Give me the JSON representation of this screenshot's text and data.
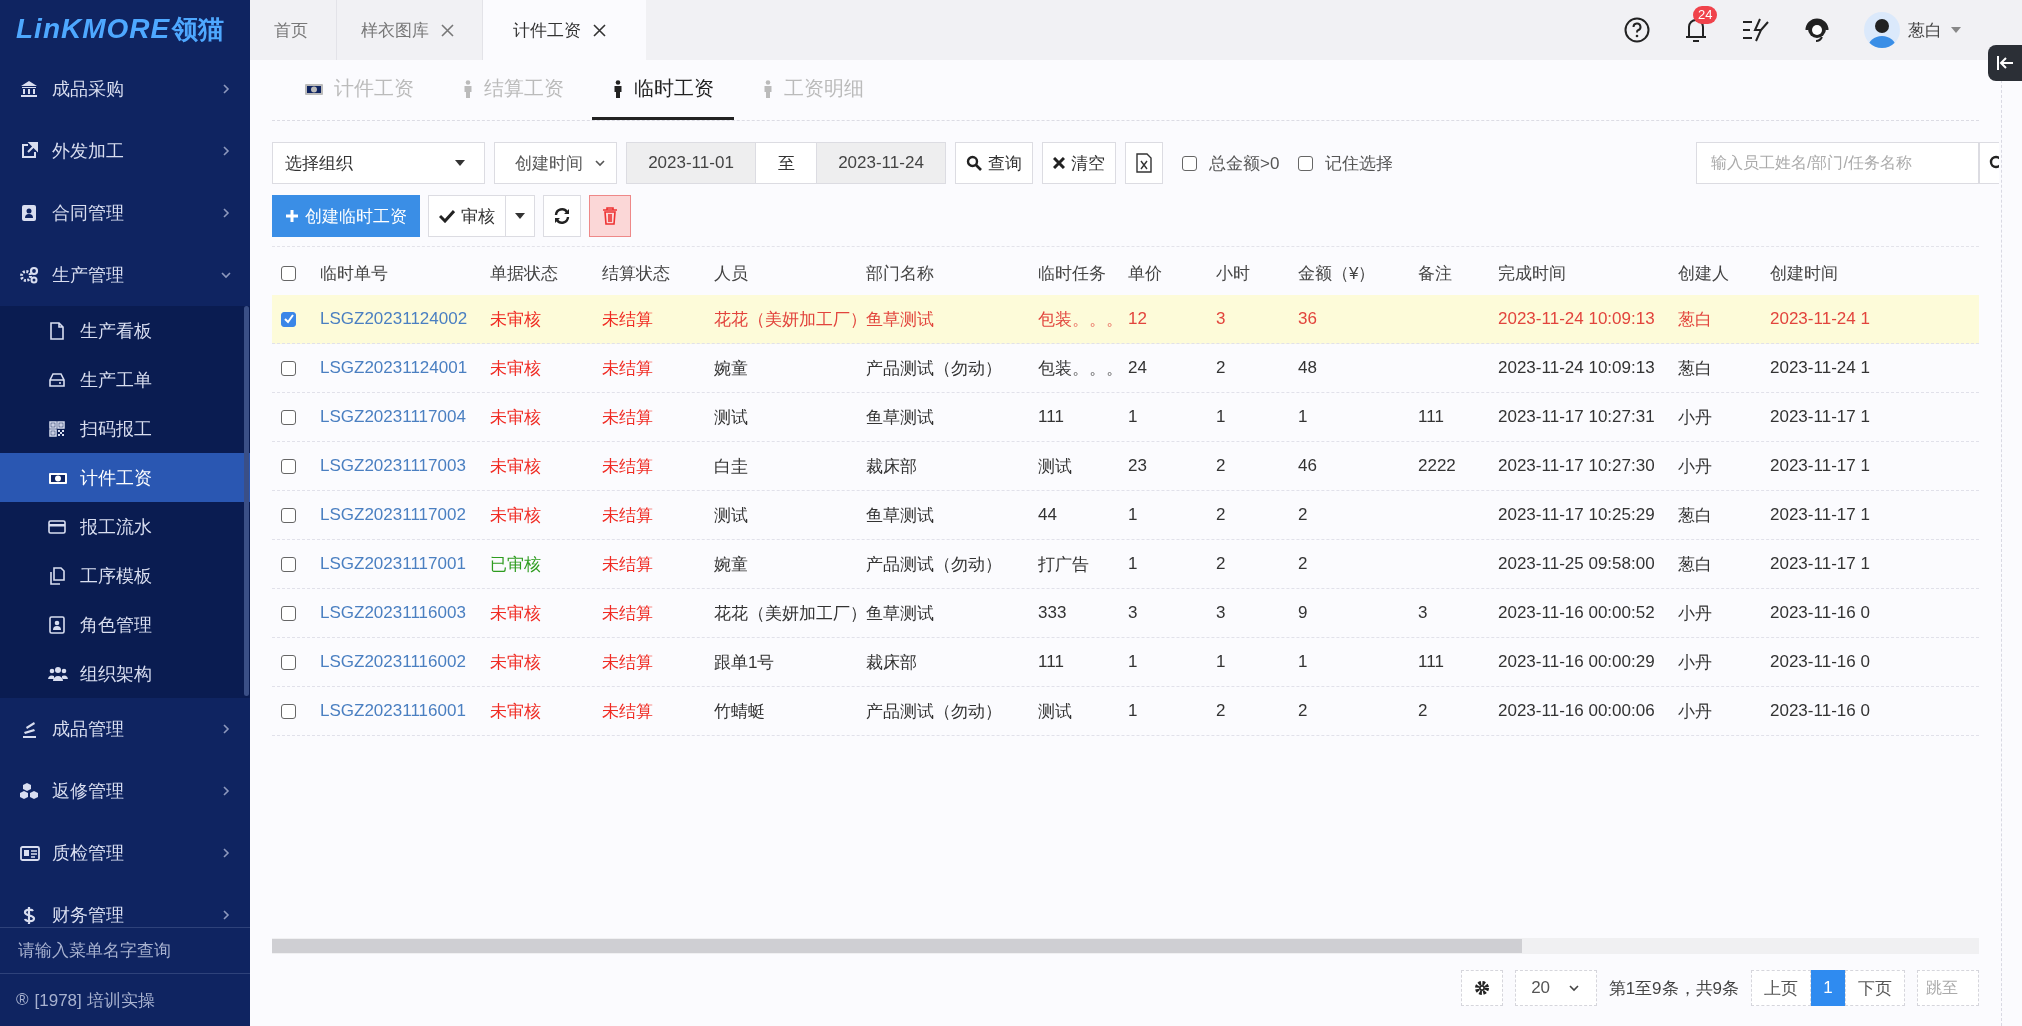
{
  "brand": {
    "logo": "LinKMORE",
    "logo_cn": "领猫"
  },
  "sidebar": {
    "items": [
      {
        "label": "成品采购",
        "expanded": false,
        "selected": false
      },
      {
        "label": "外发加工",
        "expanded": false,
        "selected": false
      },
      {
        "label": "合同管理",
        "expanded": false,
        "selected": false
      },
      {
        "label": "生产管理",
        "expanded": true,
        "selected": false,
        "children": [
          {
            "label": "生产看板",
            "selected": false
          },
          {
            "label": "生产工单",
            "selected": false
          },
          {
            "label": "扫码报工",
            "selected": false
          },
          {
            "label": "计件工资",
            "selected": true
          },
          {
            "label": "报工流水",
            "selected": false
          },
          {
            "label": "工序模板",
            "selected": false
          },
          {
            "label": "角色管理",
            "selected": false
          },
          {
            "label": "组织架构",
            "selected": false
          }
        ]
      },
      {
        "label": "成品管理",
        "expanded": false,
        "selected": false
      },
      {
        "label": "返修管理",
        "expanded": false,
        "selected": false
      },
      {
        "label": "质检管理",
        "expanded": false,
        "selected": false
      },
      {
        "label": "财务管理",
        "expanded": false,
        "selected": false
      }
    ],
    "search_placeholder": "请输入菜单名字查询",
    "footer_mark": "®",
    "footer": "[1978] 培训实操"
  },
  "tabs": [
    {
      "label": "首页",
      "selected": false,
      "closable": false
    },
    {
      "label": "样衣图库",
      "selected": false,
      "closable": true
    },
    {
      "label": "计件工资",
      "selected": true,
      "closable": true
    }
  ],
  "header": {
    "notification_count": "24",
    "user": "葱白"
  },
  "subtabs": [
    {
      "label": "计件工资",
      "selected": false
    },
    {
      "label": "结算工资",
      "selected": false
    },
    {
      "label": "临时工资",
      "selected": true
    },
    {
      "label": "工资明细",
      "selected": false
    }
  ],
  "filters": {
    "org": "选择组织",
    "time_field": "创建时间",
    "date_from": "2023-11-01",
    "date_sep": "至",
    "date_to": "2023-11-24",
    "query": "查询",
    "clear": "清空",
    "checkboxes": [
      {
        "label": "总金额>0",
        "checked": false
      },
      {
        "label": "记住选择",
        "checked": false
      }
    ],
    "search_placeholder": "输入员工姓名/部门/任务名称"
  },
  "actions": {
    "create": "创建临时工资",
    "approve": "审核"
  },
  "table": {
    "all_checked": false,
    "columns": [
      "临时单号",
      "单据状态",
      "结算状态",
      "人员",
      "部门名称",
      "临时任务",
      "单价",
      "小时",
      "金额（¥）",
      "备注",
      "完成时间",
      "创建人",
      "创建时间"
    ],
    "rows": [
      {
        "selected": true,
        "approved": false,
        "cells": [
          "LSGZ20231124002",
          "未审核",
          "未结算",
          "花花（美妍加工厂）",
          "鱼草测试",
          "包装。。。",
          "12",
          "3",
          "36",
          "",
          "2023-11-24 10:09:13",
          "葱白",
          "2023-11-24 1"
        ]
      },
      {
        "selected": false,
        "approved": false,
        "cells": [
          "LSGZ20231124001",
          "未审核",
          "未结算",
          "婉童",
          "产品测试（勿动）",
          "包装。。。",
          "24",
          "2",
          "48",
          "",
          "2023-11-24 10:09:13",
          "葱白",
          "2023-11-24 1"
        ]
      },
      {
        "selected": false,
        "approved": false,
        "cells": [
          "LSGZ20231117004",
          "未审核",
          "未结算",
          "测试",
          "鱼草测试",
          "111",
          "1",
          "1",
          "1",
          "111",
          "2023-11-17 10:27:31",
          "小丹",
          "2023-11-17 1"
        ]
      },
      {
        "selected": false,
        "approved": false,
        "cells": [
          "LSGZ20231117003",
          "未审核",
          "未结算",
          "白圭",
          "裁床部",
          "测试",
          "23",
          "2",
          "46",
          "2222",
          "2023-11-17 10:27:30",
          "小丹",
          "2023-11-17 1"
        ]
      },
      {
        "selected": false,
        "approved": false,
        "cells": [
          "LSGZ20231117002",
          "未审核",
          "未结算",
          "测试",
          "鱼草测试",
          "44",
          "1",
          "2",
          "2",
          "",
          "2023-11-17 10:25:29",
          "葱白",
          "2023-11-17 1"
        ]
      },
      {
        "selected": false,
        "approved": true,
        "cells": [
          "LSGZ20231117001",
          "已审核",
          "未结算",
          "婉童",
          "产品测试（勿动）",
          "打广告",
          "1",
          "2",
          "2",
          "",
          "2023-11-25 09:58:00",
          "葱白",
          "2023-11-17 1"
        ]
      },
      {
        "selected": false,
        "approved": false,
        "cells": [
          "LSGZ20231116003",
          "未审核",
          "未结算",
          "花花（美妍加工厂）",
          "鱼草测试",
          "333",
          "3",
          "3",
          "9",
          "3",
          "2023-11-16 00:00:52",
          "小丹",
          "2023-11-16 0"
        ]
      },
      {
        "selected": false,
        "approved": false,
        "cells": [
          "LSGZ20231116002",
          "未审核",
          "未结算",
          "跟单1号",
          "裁床部",
          "111",
          "1",
          "1",
          "1",
          "111",
          "2023-11-16 00:00:29",
          "小丹",
          "2023-11-16 0"
        ]
      },
      {
        "selected": false,
        "approved": false,
        "cells": [
          "LSGZ20231116001",
          "未审核",
          "未结算",
          "竹蜻蜓",
          "产品测试（勿动）",
          "测试",
          "1",
          "2",
          "2",
          "2",
          "2023-11-16 00:00:06",
          "小丹",
          "2023-11-16 0"
        ]
      }
    ]
  },
  "pager": {
    "page_size": "20",
    "summary": "第1至9条，共9条",
    "prev": "上页",
    "pages": [
      {
        "label": "1",
        "selected": true
      }
    ],
    "next": "下页",
    "jump_placeholder": "跳至"
  }
}
